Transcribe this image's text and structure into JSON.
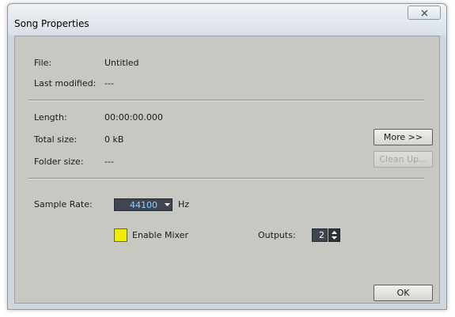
{
  "window": {
    "title": "Song Properties"
  },
  "file_info": {
    "file_label": "File:",
    "file_value": "Untitled",
    "modified_label": "Last modified:",
    "modified_value": "---"
  },
  "size_info": {
    "length_label": "Length:",
    "length_value": "00:00:00.000",
    "total_label": "Total size:",
    "total_value": "0 kB",
    "folder_label": "Folder size:",
    "folder_value": "---",
    "more_label": "More >>",
    "cleanup_label": "Clean Up..."
  },
  "audio": {
    "sample_rate_label": "Sample Rate:",
    "sample_rate_value": "44100",
    "sample_rate_unit": "Hz",
    "enable_mixer_label": "Enable Mixer",
    "enable_mixer_checked": true,
    "outputs_label": "Outputs:",
    "outputs_value": "2"
  },
  "footer": {
    "ok_label": "OK"
  },
  "colors": {
    "checkbox_fill": "#f2ec00",
    "dropdown_text": "#8fd0ff",
    "field_background": "#3f4652"
  }
}
